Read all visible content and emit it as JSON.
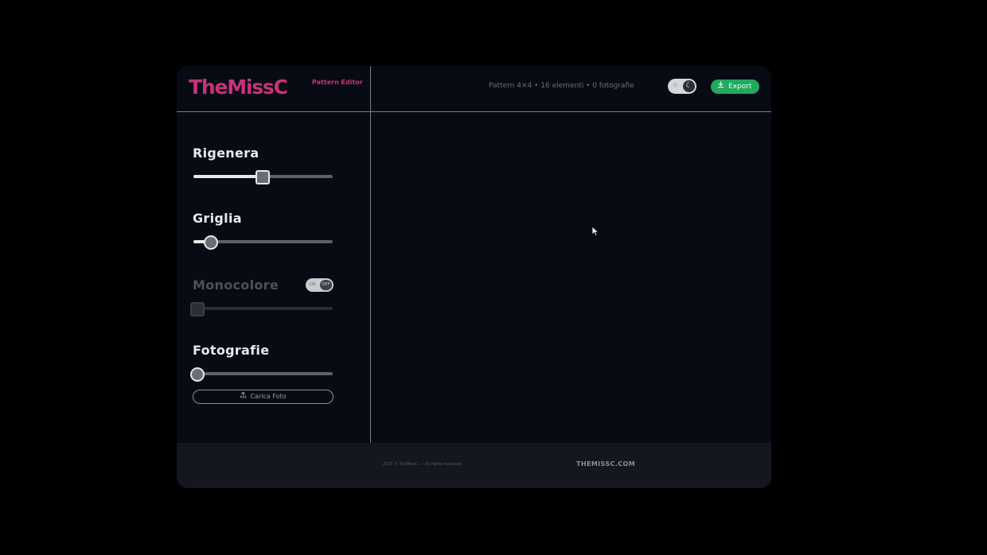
{
  "header": {
    "logo": "TheMissC",
    "logo_sub": "Pattern Editor",
    "pattern_info": "Pattern 4×4 • 16 elementi • 0 fotografie",
    "theme_toggle": {
      "sun_icon": "sun-icon",
      "moon_icon": "moon-icon",
      "mode": "dark"
    },
    "export_label": "Export"
  },
  "sidebar": {
    "rigenera": {
      "title": "Rigenera",
      "value_fraction": 0.49
    },
    "griglia": {
      "title": "Griglia",
      "value_fraction": 0.12
    },
    "monocolore": {
      "title": "Monocolore",
      "value_fraction": 0.0,
      "toggle_on_label": "ON",
      "toggle_off_label": "OFF",
      "enabled": false
    },
    "fotografie": {
      "title": "Fotografie",
      "value_fraction": 0.0
    },
    "upload_label": "Carica Foto"
  },
  "footer": {
    "copyright": "2025 © TheMissC — All rights reserved",
    "site": "THEMISSC.COM"
  },
  "colors": {
    "brand": "#c8327a",
    "accent_green": "#23a860",
    "background": "#070b13"
  }
}
